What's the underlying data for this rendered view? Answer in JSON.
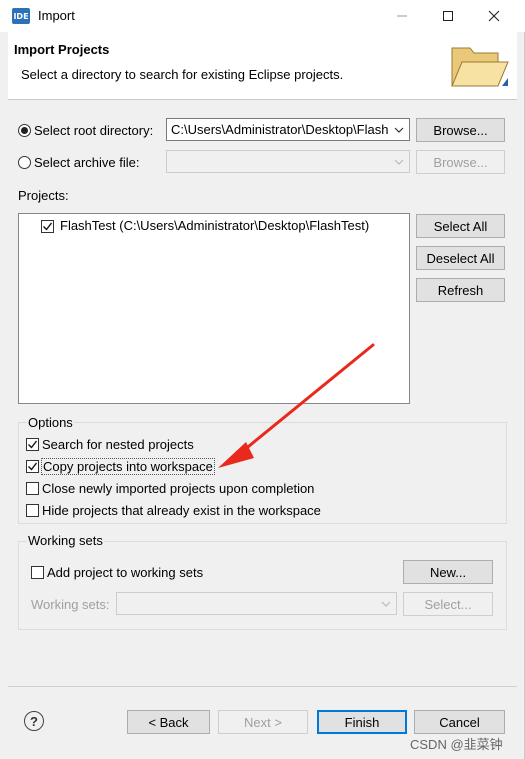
{
  "window": {
    "title": "Import",
    "icon_text": "IDE"
  },
  "header": {
    "title": "Import Projects",
    "description": "Select a directory to search for existing Eclipse projects."
  },
  "source": {
    "root_label": "Select root directory:",
    "root_selected": true,
    "root_value": "C:\\Users\\Administrator\\Desktop\\Flash",
    "archive_label": "Select archive file:",
    "archive_selected": false,
    "browse_label": "Browse...",
    "browse_archive_label": "Browse..."
  },
  "projects": {
    "label": "Projects:",
    "items": [
      {
        "label": "FlashTest (C:\\Users\\Administrator\\Desktop\\FlashTest)",
        "checked": true
      }
    ],
    "select_all": "Select All",
    "deselect_all": "Deselect All",
    "refresh": "Refresh"
  },
  "options": {
    "title": "Options",
    "items": [
      {
        "label": "Search for nested projects",
        "checked": true
      },
      {
        "label": "Copy projects into workspace",
        "checked": true
      },
      {
        "label": "Close newly imported projects upon completion",
        "checked": false
      },
      {
        "label": "Hide projects that already exist in the workspace",
        "checked": false
      }
    ]
  },
  "working_sets": {
    "title": "Working sets",
    "add_label": "Add project to working sets",
    "add_checked": false,
    "new_label": "New...",
    "sets_label": "Working sets:",
    "select_label": "Select..."
  },
  "footer": {
    "help_symbol": "?",
    "back": "< Back",
    "next": "Next >",
    "finish": "Finish",
    "cancel": "Cancel"
  },
  "watermark": "CSDN @韭菜钟",
  "colors": {
    "annotation_arrow": "#e8291c",
    "accent": "#0078d7"
  }
}
